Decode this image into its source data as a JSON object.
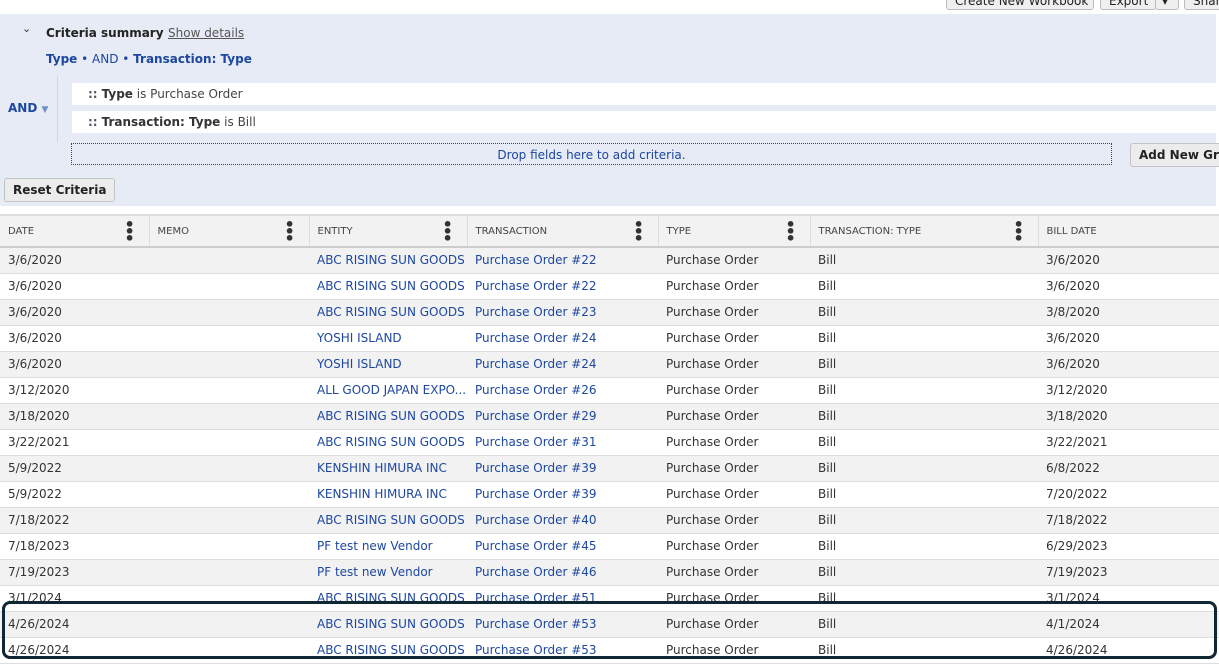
{
  "toolbar": {
    "create_workbook": "Create New Workbook",
    "export": "Export",
    "export_menu": "▾",
    "share": "Share"
  },
  "criteria": {
    "title": "Criteria summary",
    "show_details": "Show details",
    "summary": {
      "a": "Type",
      "sep1": " • AND • ",
      "b": "Transaction: Type"
    },
    "operator": "AND",
    "rows": [
      {
        "field": "Type",
        "op": "is",
        "value": "Purchase Order"
      },
      {
        "field": "Transaction: Type",
        "op": "is",
        "value": "Bill"
      }
    ],
    "drop_hint": "Drop fields here to add criteria.",
    "add_group": "Add New Group",
    "reset": "Reset Criteria"
  },
  "table": {
    "columns": [
      "DATE",
      "MEMO",
      "ENTITY",
      "TRANSACTION",
      "TYPE",
      "TRANSACTION: TYPE",
      "BILL DATE"
    ],
    "rows": [
      [
        "3/6/2020",
        "",
        "ABC RISING SUN GOODS",
        "Purchase Order #22",
        "Purchase Order",
        "Bill",
        "3/6/2020"
      ],
      [
        "3/6/2020",
        "",
        "ABC RISING SUN GOODS",
        "Purchase Order #22",
        "Purchase Order",
        "Bill",
        "3/6/2020"
      ],
      [
        "3/6/2020",
        "",
        "ABC RISING SUN GOODS",
        "Purchase Order #23",
        "Purchase Order",
        "Bill",
        "3/8/2020"
      ],
      [
        "3/6/2020",
        "",
        "YOSHI ISLAND",
        "Purchase Order #24",
        "Purchase Order",
        "Bill",
        "3/6/2020"
      ],
      [
        "3/6/2020",
        "",
        "YOSHI ISLAND",
        "Purchase Order #24",
        "Purchase Order",
        "Bill",
        "3/6/2020"
      ],
      [
        "3/12/2020",
        "",
        "ALL GOOD JAPAN EXPO...",
        "Purchase Order #26",
        "Purchase Order",
        "Bill",
        "3/12/2020"
      ],
      [
        "3/18/2020",
        "",
        "ABC RISING SUN GOODS",
        "Purchase Order #29",
        "Purchase Order",
        "Bill",
        "3/18/2020"
      ],
      [
        "3/22/2021",
        "",
        "ABC RISING SUN GOODS",
        "Purchase Order #31",
        "Purchase Order",
        "Bill",
        "3/22/2021"
      ],
      [
        "5/9/2022",
        "",
        "KENSHIN HIMURA INC",
        "Purchase Order #39",
        "Purchase Order",
        "Bill",
        "6/8/2022"
      ],
      [
        "5/9/2022",
        "",
        "KENSHIN HIMURA INC",
        "Purchase Order #39",
        "Purchase Order",
        "Bill",
        "7/20/2022"
      ],
      [
        "7/18/2022",
        "",
        "ABC RISING SUN GOODS",
        "Purchase Order #40",
        "Purchase Order",
        "Bill",
        "7/18/2022"
      ],
      [
        "7/18/2023",
        "",
        "PF test new Vendor",
        "Purchase Order #45",
        "Purchase Order",
        "Bill",
        "6/29/2023"
      ],
      [
        "7/19/2023",
        "",
        "PF test new Vendor",
        "Purchase Order #46",
        "Purchase Order",
        "Bill",
        "7/19/2023"
      ],
      [
        "3/1/2024",
        "",
        "ABC RISING SUN GOODS",
        "Purchase Order #51",
        "Purchase Order",
        "Bill",
        "3/1/2024"
      ],
      [
        "4/26/2024",
        "",
        "ABC RISING SUN GOODS",
        "Purchase Order #53",
        "Purchase Order",
        "Bill",
        "4/1/2024"
      ],
      [
        "4/26/2024",
        "",
        "ABC RISING SUN GOODS",
        "Purchase Order #53",
        "Purchase Order",
        "Bill",
        "4/26/2024"
      ]
    ]
  }
}
